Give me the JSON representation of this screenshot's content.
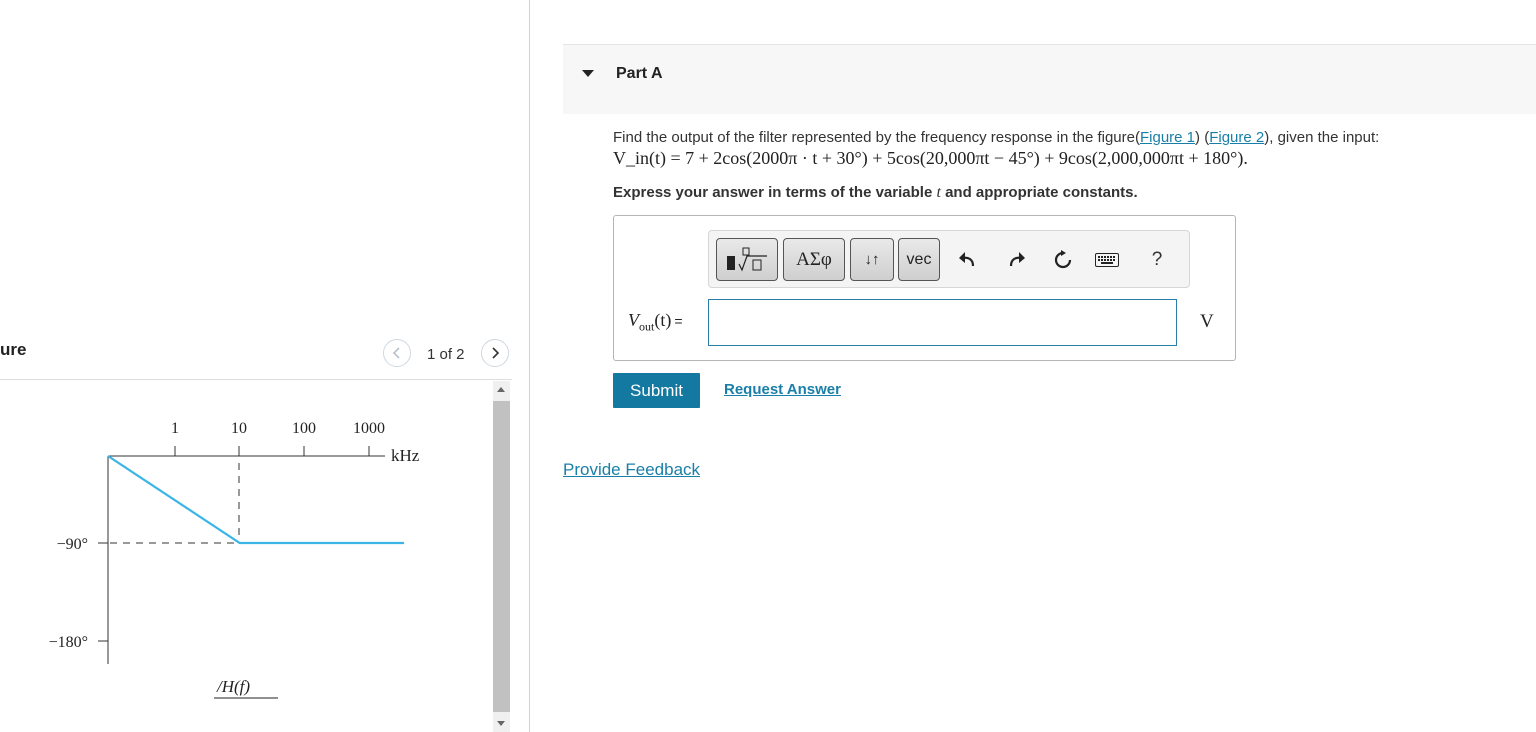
{
  "figure": {
    "title": "ure",
    "pager": {
      "count": "1 of 2"
    },
    "plot": {
      "x_ticks": [
        "1",
        "10",
        "100",
        "1000"
      ],
      "x_unit": "kHz",
      "y_ticks": [
        "−90°",
        "−180°"
      ],
      "ylabel": "/H(f)",
      "line_color": "#3ab5e6",
      "phase_curve": [
        {
          "f_khz": 1,
          "phase_deg": 0
        },
        {
          "f_khz": 10,
          "phase_deg": -90
        },
        {
          "f_khz": 10000,
          "phase_deg": -90
        }
      ]
    }
  },
  "part": {
    "title": "Part A",
    "question": {
      "prefix": "Find the output of the filter represented by the frequency response in the figure(",
      "figure1_link": "Figure 1",
      "middle": ") (",
      "figure2_link": "Figure 2",
      "suffix": "), given the input:",
      "equation": "V_in(t) = 7 + 2cos(2000π · t + 30°) + 5cos(20,000πt − 45°) + 9cos(2,000,000πt + 180°)."
    },
    "instruction": {
      "prefix": "Express your answer in terms of the variable",
      "variable": "t",
      "suffix": "and appropriate constants."
    },
    "toolbar": {
      "greek_label": "ΑΣφ",
      "arrows_label": "↓↑",
      "vec_label": "vec",
      "help_label": "?"
    },
    "answer": {
      "label_var": "V",
      "label_sub": "out",
      "label_arg": "(t)",
      "label_eq": "=",
      "value": "",
      "unit": "V"
    },
    "submit_label": "Submit",
    "request_label": "Request Answer"
  },
  "feedback_label": "Provide Feedback",
  "colors": {
    "accent": "#1479a0",
    "link": "#1a7fa8"
  }
}
